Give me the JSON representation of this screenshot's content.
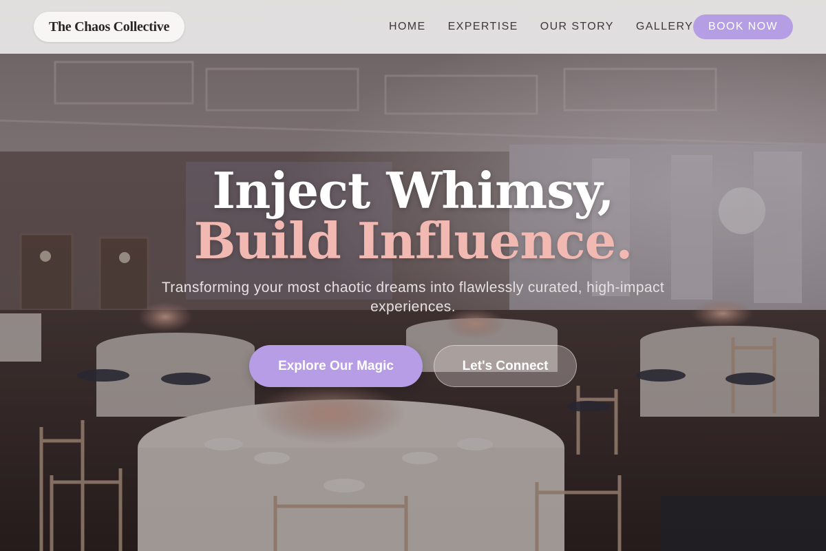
{
  "nav": {
    "logo": "The Chaos Collective",
    "links": [
      "HOME",
      "EXPERTISE",
      "OUR STORY",
      "GALLERY"
    ],
    "cta": "BOOK NOW"
  },
  "hero": {
    "headline_line1": "Inject Whimsy,",
    "headline_line2": "Build Influence.",
    "subtitle": "Transforming your most chaotic dreams into flawlessly curated, high-impact experiences.",
    "primary_cta": "Explore Our Magic",
    "secondary_cta": "Let's Connect",
    "background_icon": "ballroom-photo"
  },
  "colors": {
    "accent_lavender": "#b59ee3",
    "headline_white": "#ffffff",
    "headline_pink": "#f2b8b2",
    "nav_bg": "#eceaea"
  }
}
